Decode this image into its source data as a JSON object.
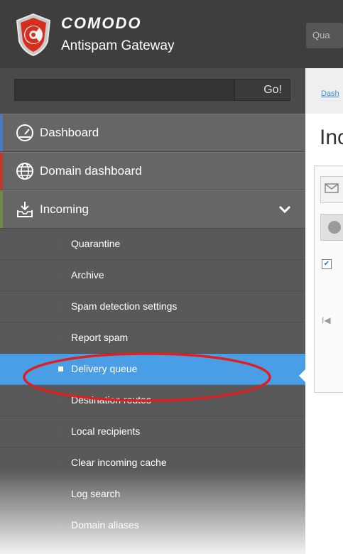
{
  "app": {
    "brand": "COMODO",
    "product": "Antispam Gateway",
    "header_button": "Qua"
  },
  "search": {
    "value": "",
    "button": "Go!"
  },
  "sidebar": {
    "items": [
      {
        "label": "Dashboard",
        "icon": "gauge-icon",
        "accent": "#4a78c4"
      },
      {
        "label": "Domain dashboard",
        "icon": "globe-icon",
        "accent": "#c0392b"
      },
      {
        "label": "Incoming",
        "icon": "inbox-download-icon",
        "accent": "#6e8a4a",
        "expanded": true
      }
    ],
    "subitems": [
      {
        "label": "Quarantine",
        "active": false
      },
      {
        "label": "Archive",
        "active": false
      },
      {
        "label": "Spam detection settings",
        "active": false
      },
      {
        "label": "Report spam",
        "active": false
      },
      {
        "label": "Delivery queue",
        "active": true
      },
      {
        "label": "Destination routes",
        "active": false
      },
      {
        "label": "Local recipients",
        "active": false
      },
      {
        "label": "Clear incoming cache",
        "active": false
      },
      {
        "label": "Log search",
        "active": false
      },
      {
        "label": "Domain aliases",
        "active": false
      }
    ]
  },
  "main": {
    "breadcrumb": "Dash",
    "title": "Inc",
    "pager_glyph": "I◀",
    "checkbox_checked": true
  },
  "colors": {
    "active_item": "#4a9ee5",
    "annotation": "#e02020",
    "link": "#3a8fd8"
  }
}
